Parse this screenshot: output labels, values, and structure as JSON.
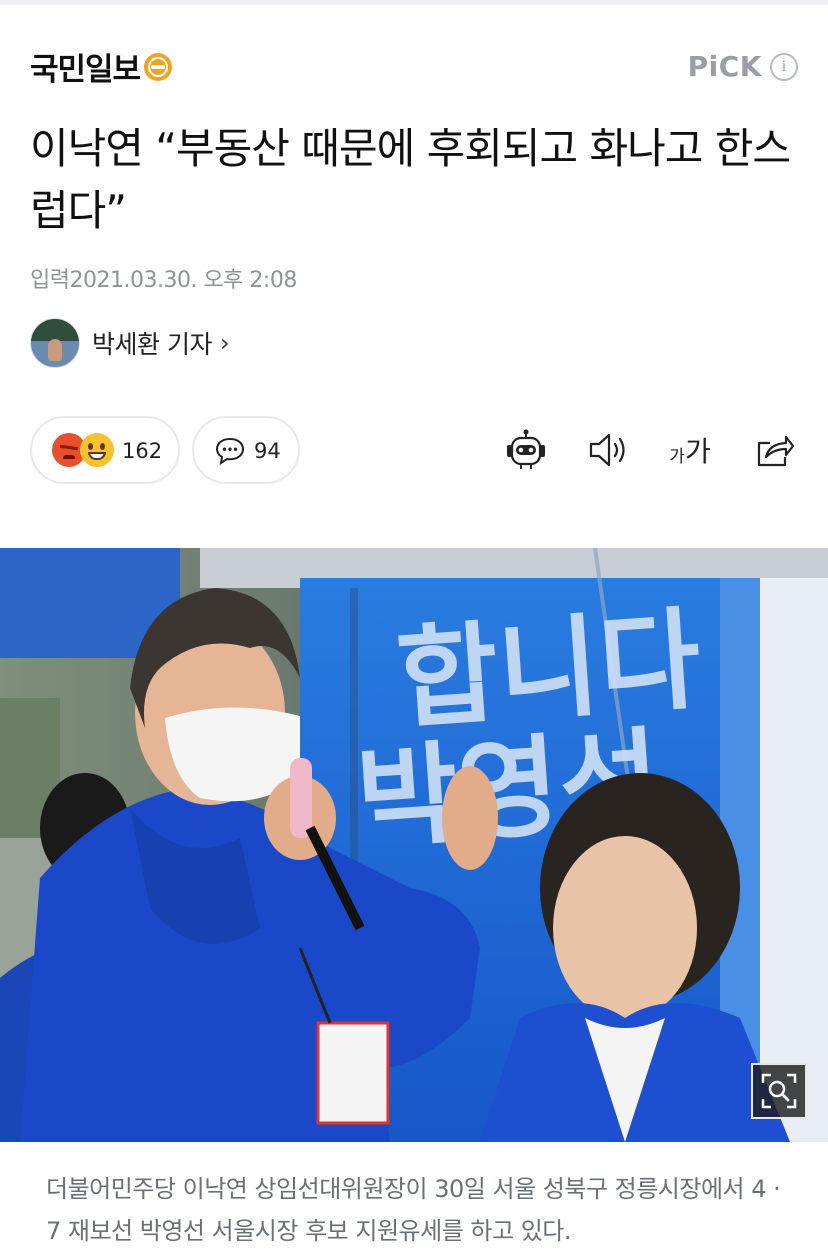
{
  "header": {
    "brand": "국민일보",
    "pick_label": "PiCK",
    "info_icon_label": "i"
  },
  "article": {
    "title": "이낙연 “부동산 때문에 후회되고 화나고 한스럽다”",
    "date_label": "입력",
    "date_value": "2021.03.30. 오후 2:08",
    "reporter": "박세환 기자",
    "reporter_chevron": "›"
  },
  "actions": {
    "reaction_count": "162",
    "comment_count": "94",
    "font_small": "가",
    "font_big": "가"
  },
  "photo": {
    "banner_line1": "합니다",
    "banner_line2": "박영선"
  },
  "caption": "더불어민주당 이낙연 상임선대위원장이 30일 서울 성북구 정릉시장에서 4 · 7 재보선 박영선 서울시장 후보 지원유세를 하고 있다.",
  "colors": {
    "brand_accent": "#f0a31f",
    "banner_blue": "#1f6fd6",
    "jacket_blue": "#1a48c8"
  }
}
